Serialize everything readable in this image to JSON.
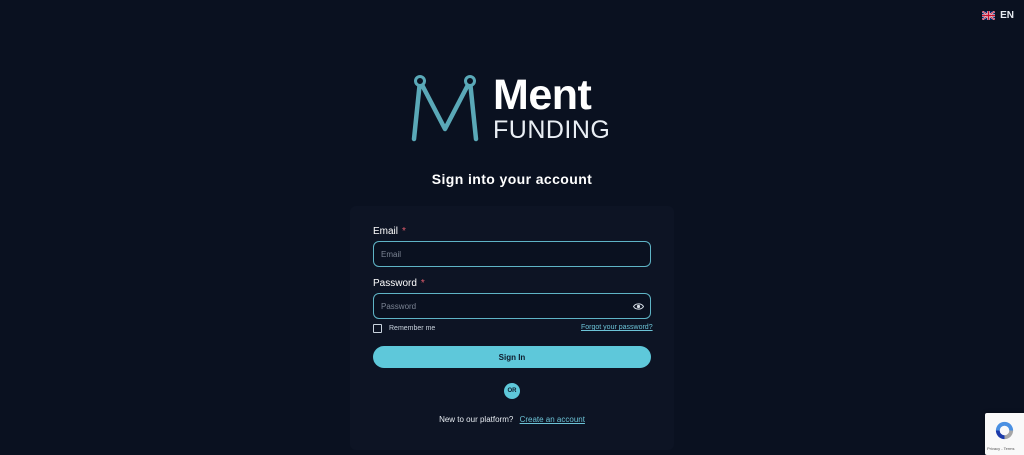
{
  "language": {
    "code": "EN",
    "flag_icon": "uk-flag-icon"
  },
  "logo": {
    "word": "Ment",
    "subword": "FUNDING",
    "mark_color": "#5aa9b8"
  },
  "title": "Sign into your account",
  "form": {
    "email": {
      "label": "Email",
      "required_mark": "*",
      "placeholder": "Email",
      "value": ""
    },
    "password": {
      "label": "Password",
      "required_mark": "*",
      "placeholder": "Password",
      "value": "",
      "toggle_icon": "eye-icon"
    },
    "remember_me": {
      "label": "Remember me",
      "checked": false
    },
    "forgot_password": "Forgot your password?",
    "submit_label": "Sign In",
    "divider": "OR"
  },
  "signup": {
    "prompt": "New to our platform?",
    "link": "Create an account"
  },
  "recaptcha": {
    "links": "Privacy - Terms"
  },
  "colors": {
    "background": "#0a1120",
    "accent": "#5ec8da",
    "field_border": "#5fb4c6",
    "required": "#e05c6c"
  }
}
